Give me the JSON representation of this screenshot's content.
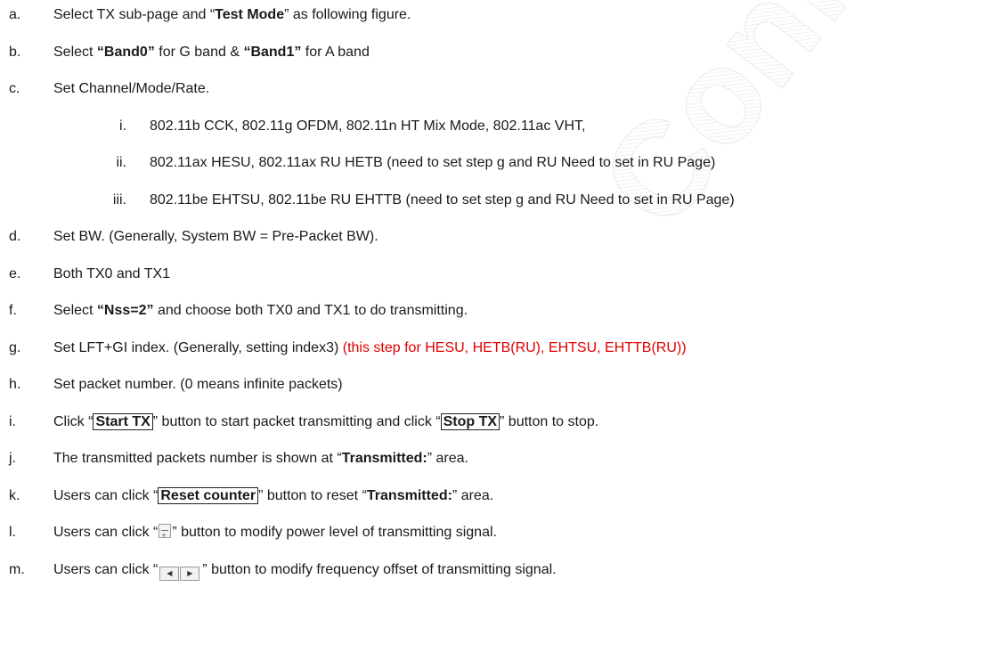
{
  "watermark": "Confidential",
  "items": {
    "a": {
      "letter": "a.",
      "p1": "Select TX sub-page and “",
      "b1": "Test Mode",
      "p2": "” as following figure."
    },
    "b": {
      "letter": "b.",
      "p1": "Select ",
      "b1": "“Band0”",
      "p2": " for G band & ",
      "b2": "“Band1”",
      "p3": " for A band"
    },
    "c": {
      "letter": "c.",
      "text": "Set Channel/Mode/Rate."
    },
    "c_i": {
      "num": "i.",
      "text": "802.11b CCK, 802.11g OFDM, 802.11n HT Mix Mode, 802.11ac VHT,"
    },
    "c_ii": {
      "num": "ii.",
      "text": "802.11ax HESU, 802.11ax RU HETB (need to set step g and RU Need to set in RU Page)"
    },
    "c_iii": {
      "num": "iii.",
      "text": "802.11be EHTSU, 802.11be RU EHTTB (need to set step g and RU Need to set in RU Page)"
    },
    "d": {
      "letter": "d.",
      "text": "Set BW. (Generally, System BW = Pre-Packet BW)."
    },
    "e": {
      "letter": "e.",
      "text": "Both TX0 and TX1"
    },
    "f": {
      "letter": "f.",
      "p1": "Select ",
      "b1": "“Nss=2”",
      "p2": " and choose both TX0 and TX1 to do transmitting."
    },
    "g": {
      "letter": "g.",
      "p1": "Set LFT+GI index. (Generally, setting index3) ",
      "red": "(this step for HESU, HETB(RU), EHTSU, EHTTB(RU))"
    },
    "h": {
      "letter": "h.",
      "text": "Set packet number. (0 means infinite packets)"
    },
    "i": {
      "letter": "i.",
      "p1": "Click “",
      "btn1": "Start TX",
      "p2": "” button to start packet transmitting and click “",
      "btn2": "Stop TX",
      "p3": "” button to stop."
    },
    "j": {
      "letter": "j.",
      "p1": "The transmitted packets number is shown at “",
      "b1": "Transmitted:",
      "p2": "” area."
    },
    "k": {
      "letter": "k.",
      "p1": "Users can click “",
      "btn1": "Reset counter",
      "p2": "” button to reset “",
      "b1": "Transmitted:",
      "p3": "” area."
    },
    "l": {
      "letter": "l.",
      "p1": "Users can click “",
      "p2": "” button to modify power level of transmitting signal."
    },
    "m": {
      "letter": "m.",
      "p1": "Users can click “",
      "p2": "” button to modify frequency offset of transmitting signal."
    }
  }
}
